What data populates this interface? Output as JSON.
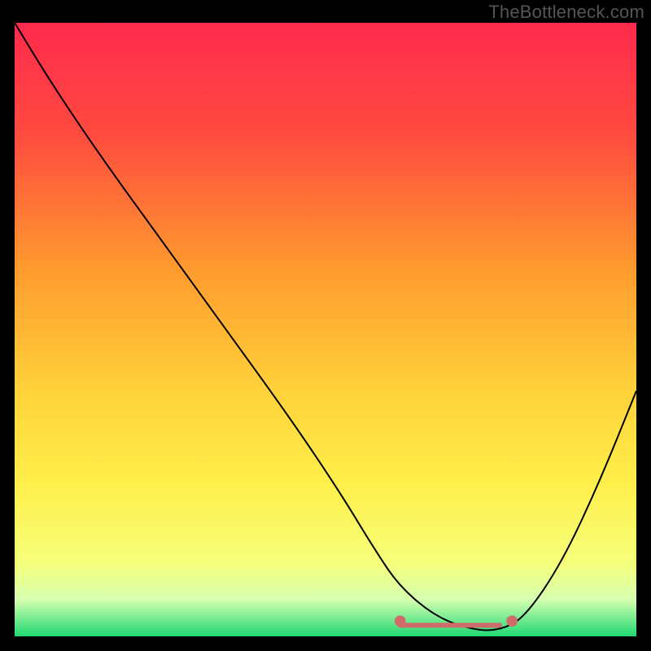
{
  "watermark": "TheBottleneck.com",
  "chart_data": {
    "type": "line",
    "title": "",
    "xlabel": "",
    "ylabel": "",
    "xlim": [
      0,
      100
    ],
    "ylim": [
      0,
      100
    ],
    "grid": false,
    "legend": false,
    "background": {
      "stops": [
        {
          "offset": 0,
          "color": "#ff2a4d"
        },
        {
          "offset": 18,
          "color": "#ff4a3f"
        },
        {
          "offset": 40,
          "color": "#ff9a2e"
        },
        {
          "offset": 60,
          "color": "#ffd23a"
        },
        {
          "offset": 75,
          "color": "#ffef4a"
        },
        {
          "offset": 88,
          "color": "#f6ff7a"
        },
        {
          "offset": 94,
          "color": "#d6ffb0"
        },
        {
          "offset": 100,
          "color": "#1fd873"
        }
      ]
    },
    "series": [
      {
        "name": "bottleneck-curve",
        "x": [
          0,
          6,
          14,
          24,
          34,
          44,
          52,
          58,
          62,
          68,
          74,
          78,
          82,
          88,
          94,
          100
        ],
        "values": [
          100,
          90,
          78,
          64,
          50,
          36,
          24,
          14,
          8,
          3,
          1,
          1,
          3,
          12,
          25,
          40
        ]
      }
    ],
    "markers": [
      {
        "name": "flat-region-start",
        "x": 62,
        "y": 2.5,
        "color": "#d16a6a"
      },
      {
        "name": "flat-region-end",
        "x": 80,
        "y": 2.5,
        "color": "#d16a6a"
      }
    ],
    "flat_region_bar": {
      "x0": 62,
      "x1": 78,
      "y": 1.8,
      "color": "#d16a6a"
    }
  }
}
